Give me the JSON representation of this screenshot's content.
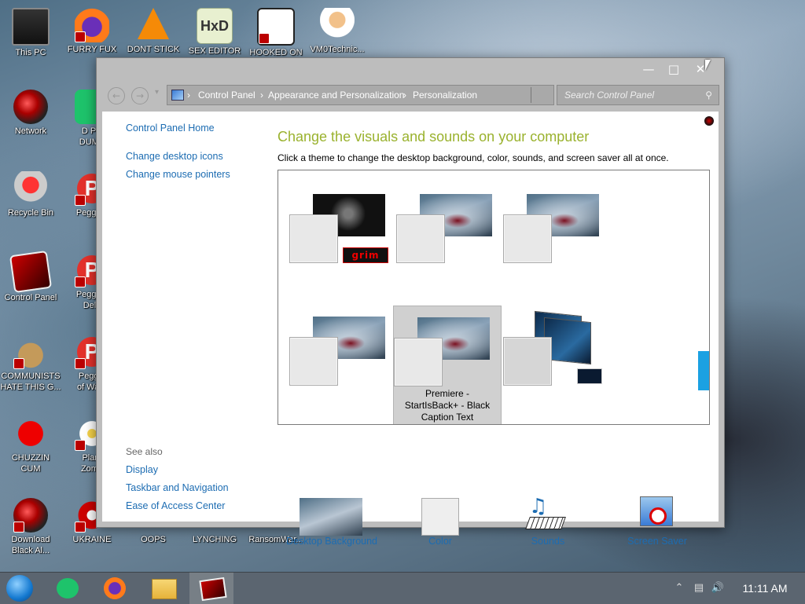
{
  "desktop": {
    "icons": [
      {
        "label": "This PC",
        "icon": "pc-icon"
      },
      {
        "label": "FURRY FUX",
        "icon": "browser-icon"
      },
      {
        "label": "DONT STICK",
        "icon": "vlc-cone-icon"
      },
      {
        "label": "SEX EDITOR",
        "icon": "hxd-icon"
      },
      {
        "label": "HOOKED ON",
        "icon": "hooked-icon"
      },
      {
        "label": "VM0Technic...",
        "icon": "doctor-icon"
      },
      {
        "label": "Network",
        "icon": "network-icon"
      },
      {
        "label": "D PC\nDUMB",
        "icon": "green-app-icon"
      },
      {
        "label": "Recycle Bin",
        "icon": "recycle-bin-icon"
      },
      {
        "label": "Peggie I",
        "icon": "peggie-icon"
      },
      {
        "label": "Control Panel",
        "icon": "control-panel-icon"
      },
      {
        "label": "Peggie I\nDelu",
        "icon": "peggie-icon"
      },
      {
        "label": "COMMUNISTS\nHATE THIS G...",
        "icon": "money-bag-icon"
      },
      {
        "label": "Peggie\nof Ward",
        "icon": "peggie-icon"
      },
      {
        "label": "CHUZZIN\nCUM",
        "icon": "chuzzle-icon"
      },
      {
        "label": "Plant\nZomb",
        "icon": "flower-icon"
      },
      {
        "label": "Download\nBlack Al...",
        "icon": "download-icon"
      },
      {
        "label": "UKRAINE",
        "icon": "ukraine-icon"
      },
      {
        "label": "OOPS",
        "icon": "oops-icon"
      },
      {
        "label": "LYNCHING",
        "icon": "lynching-icon"
      },
      {
        "label": "RansomWar...",
        "icon": "ransomware-icon"
      }
    ]
  },
  "window": {
    "controls": {
      "minimize": "—",
      "maximize": "□",
      "close": "✕"
    },
    "breadcrumb": [
      "Control Panel",
      "Appearance and Personalization",
      "Personalization"
    ],
    "search_placeholder": "Search Control Panel",
    "sidebar": {
      "home": "Control Panel Home",
      "links": [
        "Change desktop icons",
        "Change mouse pointers"
      ],
      "see_also_title": "See also",
      "see_also": [
        "Display",
        "Taskbar and Navigation",
        "Ease of Access Center"
      ]
    },
    "heading": "Change the visuals and sounds on your computer",
    "subtext": "Click a theme to change the desktop background, color, sounds, and screen saver all at once.",
    "themes": [
      {
        "name": "",
        "badge": "grim"
      },
      {
        "name": ""
      },
      {
        "name": ""
      },
      {
        "name": ""
      },
      {
        "name": "Premiere -\nStartIsBack+ - Black\nCaption Text",
        "selected": true
      },
      {
        "name": ""
      }
    ],
    "bottom": {
      "background": "Desktop Background",
      "color": "Color",
      "sounds": "Sounds",
      "screensaver": "Screen Saver"
    }
  },
  "taskbar": {
    "clock": "11:11 AM",
    "accent": "#1ba1e2"
  }
}
